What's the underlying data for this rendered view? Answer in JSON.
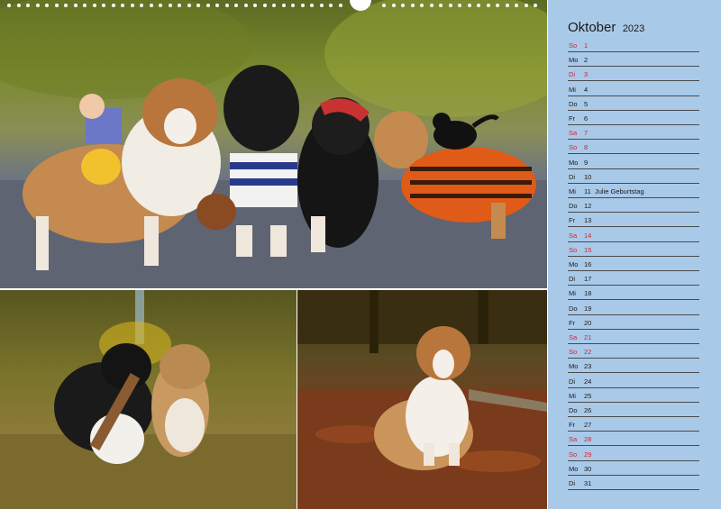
{
  "calendar": {
    "month": "Oktober",
    "year": "2023",
    "weekend_color": "#d2242a",
    "sidebar_color": "#a9c9e9",
    "days": [
      {
        "name": "So",
        "num": "1",
        "weekend": true,
        "note": ""
      },
      {
        "name": "Mo",
        "num": "2",
        "weekend": false,
        "note": ""
      },
      {
        "name": "Di",
        "num": "3",
        "weekend": true,
        "note": ""
      },
      {
        "name": "Mi",
        "num": "4",
        "weekend": false,
        "note": ""
      },
      {
        "name": "Do",
        "num": "5",
        "weekend": false,
        "note": ""
      },
      {
        "name": "Fr",
        "num": "6",
        "weekend": false,
        "note": ""
      },
      {
        "name": "Sa",
        "num": "7",
        "weekend": true,
        "note": ""
      },
      {
        "name": "So",
        "num": "8",
        "weekend": true,
        "note": ""
      },
      {
        "name": "Mo",
        "num": "9",
        "weekend": false,
        "note": ""
      },
      {
        "name": "Di",
        "num": "10",
        "weekend": false,
        "note": ""
      },
      {
        "name": "Mi",
        "num": "11",
        "weekend": false,
        "note": "Julie Geburtstag"
      },
      {
        "name": "Do",
        "num": "12",
        "weekend": false,
        "note": ""
      },
      {
        "name": "Fr",
        "num": "13",
        "weekend": false,
        "note": ""
      },
      {
        "name": "Sa",
        "num": "14",
        "weekend": true,
        "note": ""
      },
      {
        "name": "So",
        "num": "15",
        "weekend": true,
        "note": ""
      },
      {
        "name": "Mo",
        "num": "16",
        "weekend": false,
        "note": ""
      },
      {
        "name": "Di",
        "num": "17",
        "weekend": false,
        "note": ""
      },
      {
        "name": "Mi",
        "num": "18",
        "weekend": false,
        "note": ""
      },
      {
        "name": "Do",
        "num": "19",
        "weekend": false,
        "note": ""
      },
      {
        "name": "Fr",
        "num": "20",
        "weekend": false,
        "note": ""
      },
      {
        "name": "Sa",
        "num": "21",
        "weekend": true,
        "note": ""
      },
      {
        "name": "So",
        "num": "22",
        "weekend": true,
        "note": ""
      },
      {
        "name": "Mo",
        "num": "23",
        "weekend": false,
        "note": ""
      },
      {
        "name": "Di",
        "num": "24",
        "weekend": false,
        "note": ""
      },
      {
        "name": "Mi",
        "num": "25",
        "weekend": false,
        "note": ""
      },
      {
        "name": "Do",
        "num": "26",
        "weekend": false,
        "note": ""
      },
      {
        "name": "Fr",
        "num": "27",
        "weekend": false,
        "note": ""
      },
      {
        "name": "Sa",
        "num": "28",
        "weekend": true,
        "note": ""
      },
      {
        "name": "So",
        "num": "29",
        "weekend": true,
        "note": ""
      },
      {
        "name": "Mo",
        "num": "30",
        "weekend": false,
        "note": ""
      },
      {
        "name": "Di",
        "num": "31",
        "weekend": false,
        "note": ""
      }
    ]
  },
  "photos": {
    "top": {
      "icon": "dog-group-photo"
    },
    "bottom_left": {
      "icon": "puppies-playing-photo"
    },
    "bottom_right": {
      "icon": "sheltie-in-leaves-photo"
    }
  }
}
